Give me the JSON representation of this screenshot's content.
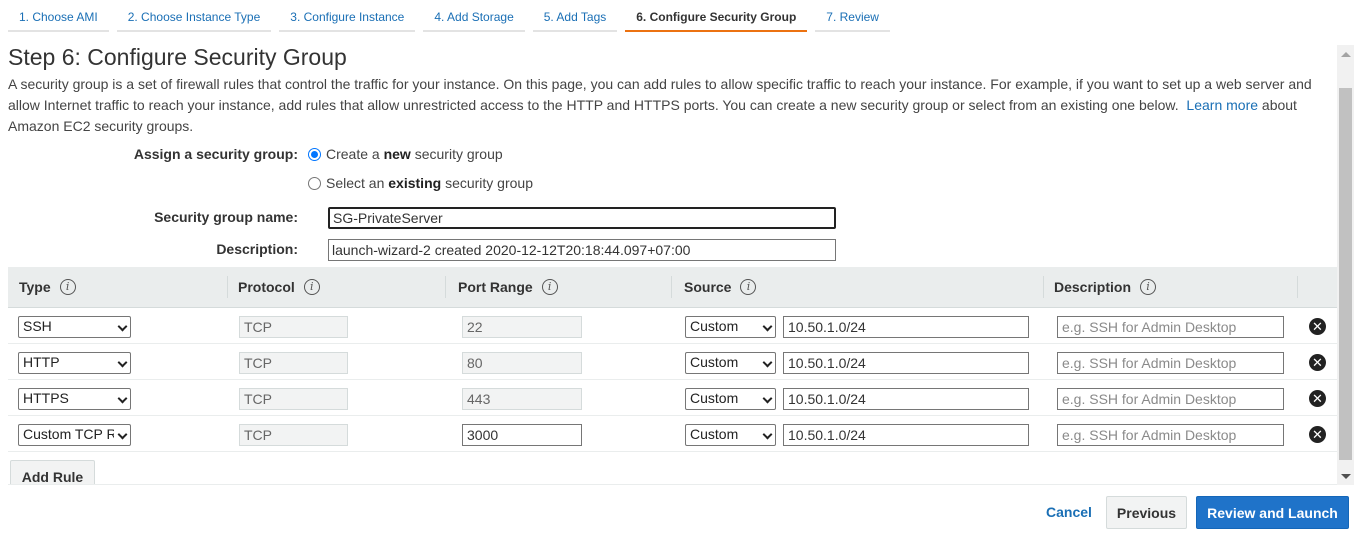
{
  "wizard": {
    "steps": [
      {
        "label": "1. Choose AMI"
      },
      {
        "label": "2. Choose Instance Type"
      },
      {
        "label": "3. Configure Instance"
      },
      {
        "label": "4. Add Storage"
      },
      {
        "label": "5. Add Tags"
      },
      {
        "label": "6. Configure Security Group"
      },
      {
        "label": "7. Review"
      }
    ],
    "active_step": "6. Configure Security Group"
  },
  "page": {
    "title": "Step 6: Configure Security Group",
    "intro_text": "A security group is a set of firewall rules that control the traffic for your instance. On this page, you can add rules to allow specific traffic to reach your instance. For example, if you want to set up a web server and allow Internet traffic to reach your instance, add rules that allow unrestricted access to the HTTP and HTTPS ports. You can create a new security group or select from an existing one below.",
    "learn_more_link": "Learn more",
    "intro_suffix": "about Amazon EC2 security groups."
  },
  "assign": {
    "label": "Assign a security group:",
    "option_create": {
      "prefix": "Create a",
      "bold": "new",
      "suffix": "security group",
      "selected": true
    },
    "option_existing": {
      "prefix": "Select an",
      "bold": "existing",
      "suffix": "security group",
      "selected": false
    }
  },
  "group_name": {
    "label": "Security group name:",
    "value": "SG-PrivateServer"
  },
  "group_description": {
    "label": "Description:",
    "value": "launch-wizard-2 created 2020-12-12T20:18:44.097+07:00"
  },
  "table": {
    "headers": {
      "type": "Type",
      "protocol": "Protocol",
      "port_range": "Port Range",
      "source": "Source",
      "description": "Description"
    },
    "info_glyph": "i",
    "delete_glyph": "✕",
    "rows": [
      {
        "type": "SSH",
        "protocol": "TCP",
        "port": "22",
        "port_editable": false,
        "source_type": "Custom",
        "source": "10.50.1.0/24",
        "description_placeholder": "e.g. SSH for Admin Desktop"
      },
      {
        "type": "HTTP",
        "protocol": "TCP",
        "port": "80",
        "port_editable": false,
        "source_type": "Custom",
        "source": "10.50.1.0/24",
        "description_placeholder": "e.g. SSH for Admin Desktop"
      },
      {
        "type": "HTTPS",
        "protocol": "TCP",
        "port": "443",
        "port_editable": false,
        "source_type": "Custom",
        "source": "10.50.1.0/24",
        "description_placeholder": "e.g. SSH for Admin Desktop"
      },
      {
        "type": "Custom TCP Rule",
        "protocol": "TCP",
        "port": "3000",
        "port_editable": true,
        "source_type": "Custom",
        "source": "10.50.1.0/24",
        "description_placeholder": "e.g. SSH for Admin Desktop"
      }
    ],
    "add_rule_label": "Add Rule"
  },
  "footer": {
    "cancel_label": "Cancel",
    "previous_label": "Previous",
    "review_launch_label": "Review and Launch"
  },
  "colors": {
    "link": "#1a6fb5",
    "active_tab_underline": "#ec7211",
    "primary_button": "#1f73c9",
    "table_header_bg": "#eaeded"
  }
}
